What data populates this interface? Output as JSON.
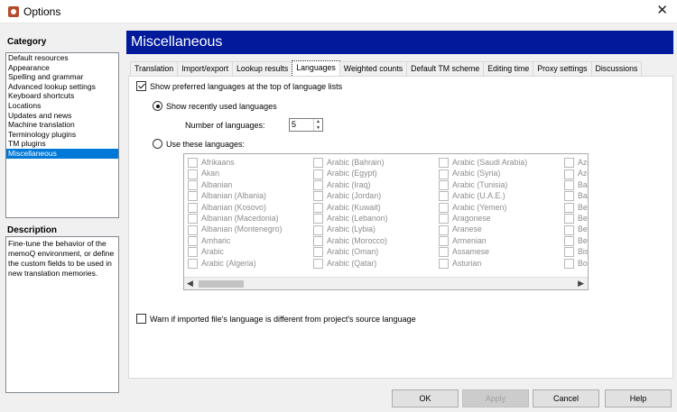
{
  "window": {
    "title": "Options",
    "close_symbol": "✕"
  },
  "category": {
    "title": "Category",
    "items": [
      "Default resources",
      "Appearance",
      "Spelling and grammar",
      "Advanced lookup settings",
      "Keyboard shortcuts",
      "Locations",
      "Updates and news",
      "Machine translation",
      "Terminology plugins",
      "TM plugins",
      "Miscellaneous"
    ],
    "selected_index": 10
  },
  "description": {
    "title": "Description",
    "text": "Fine-tune the behavior of the memoQ environment, or define the custom fields to be used in new translation memories."
  },
  "page": {
    "header": "Miscellaneous"
  },
  "tabs": [
    "Translation",
    "Import/export",
    "Lookup results",
    "Languages",
    "Weighted counts",
    "Default TM scheme",
    "Editing time",
    "Proxy settings",
    "Discussions"
  ],
  "active_tab": 3,
  "languages": {
    "show_preferred": "Show preferred languages at the top of language lists",
    "show_recent": "Show recently used languages",
    "num_label": "Number of languages:",
    "num_value": "5",
    "use_these": "Use these languages:",
    "columns": [
      [
        "Afrikaans",
        "Akan",
        "Albanian",
        "Albanian (Albania)",
        "Albanian (Kosovo)",
        "Albanian (Macedonia)",
        "Albanian (Montenegro)",
        "Amharic",
        "Arabic",
        "Arabic (Algeria)"
      ],
      [
        "Arabic (Bahrain)",
        "Arabic (Egypt)",
        "Arabic (Iraq)",
        "Arabic (Jordan)",
        "Arabic (Kuwait)",
        "Arabic (Lebanon)",
        "Arabic (Lybia)",
        "Arabic (Morocco)",
        "Arabic (Oman)",
        "Arabic (Qatar)"
      ],
      [
        "Arabic (Saudi Arabia)",
        "Arabic (Syria)",
        "Arabic (Tunisia)",
        "Arabic (U.A.E.)",
        "Arabic (Yemen)",
        "Aragonese",
        "Aranese",
        "Armenian",
        "Assamese",
        "Asturian"
      ],
      [
        "Aze",
        "Aze",
        "Bas",
        "Bas",
        "Bel",
        "Ber",
        "Ber",
        "Ber",
        "Bis",
        "Bos"
      ]
    ],
    "warn": "Warn if imported file's language is different from project's source language"
  },
  "buttons": {
    "ok": "OK",
    "apply": "Apply",
    "cancel": "Cancel",
    "help": "Help"
  }
}
